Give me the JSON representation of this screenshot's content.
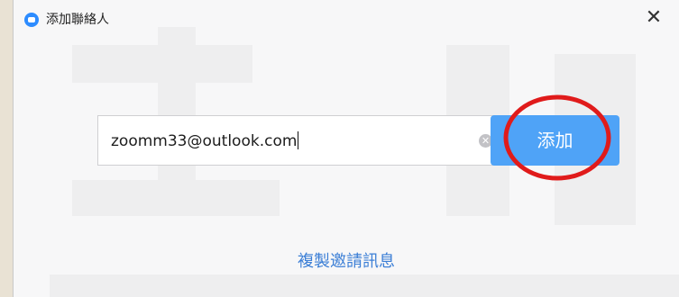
{
  "window": {
    "title": "添加聯絡人",
    "close_glyph": "✕"
  },
  "add_contact": {
    "input_value": "zoomm33@outlook.com",
    "clear_glyph": "✕",
    "add_label": "添加"
  },
  "copy_invite_link": "複製邀請訊息",
  "colors": {
    "accent": "#4fa3f7",
    "link": "#3c7fd6",
    "highlight_circle": "#e01b1b"
  }
}
